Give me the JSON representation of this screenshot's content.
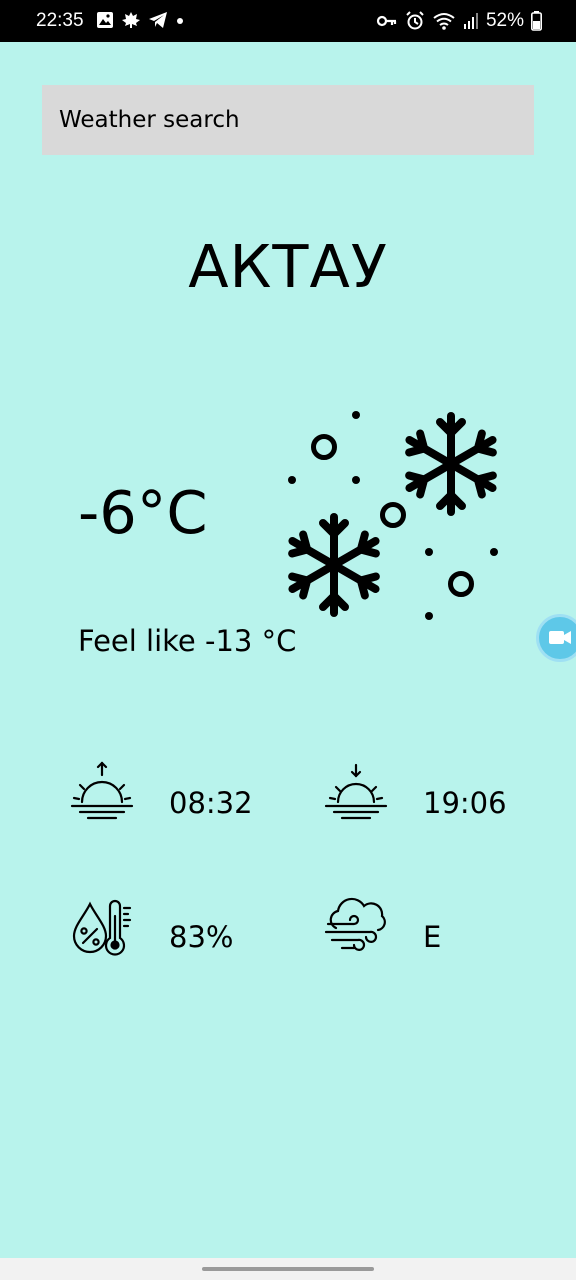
{
  "status_bar": {
    "time": "22:35",
    "battery": "52%",
    "left_icons": [
      "gallery-icon",
      "maple-leaf-icon",
      "telegram-icon",
      "dot-icon"
    ],
    "right_icons": [
      "vpn-key-icon",
      "alarm-icon",
      "wifi-icon",
      "signal-icon",
      "battery-icon"
    ]
  },
  "search": {
    "label": "Weather search"
  },
  "city": "АКТАУ",
  "current": {
    "temperature": "-6°C",
    "feels_like": "Feel like -13 °C",
    "condition_icon": "snow-icon"
  },
  "stats": {
    "sunrise": {
      "icon": "sunrise-icon",
      "value": "08:32"
    },
    "sunset": {
      "icon": "sunset-icon",
      "value": "19:06"
    },
    "humidity": {
      "icon": "humidity-thermometer-icon",
      "value": "83%"
    },
    "wind": {
      "icon": "wind-cloud-icon",
      "value": "E"
    }
  },
  "colors": {
    "background": "#b8f3ec",
    "search_bg": "#d9d9d9",
    "status_bar": "#000000",
    "floating_button": "#5ec8e8"
  }
}
